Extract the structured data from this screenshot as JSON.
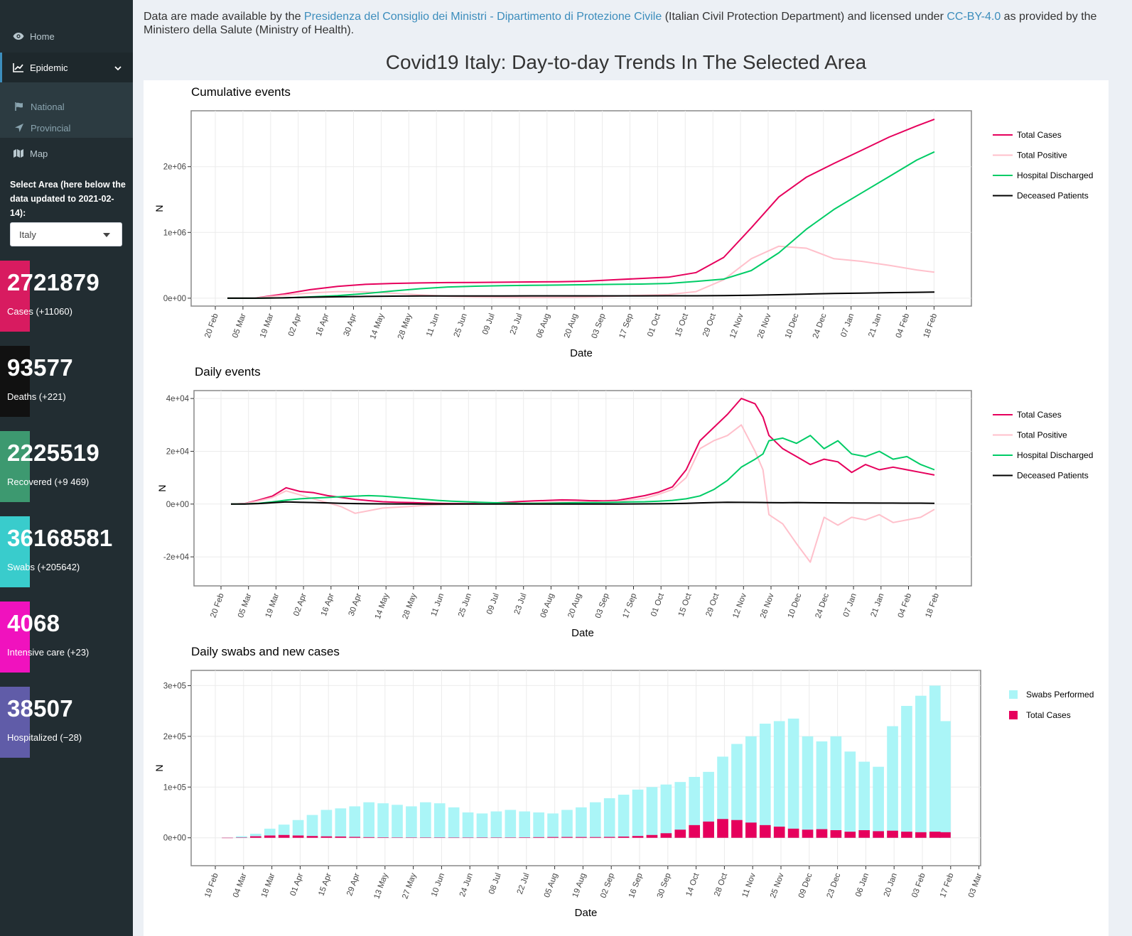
{
  "sidebar": {
    "nav": [
      {
        "label": "Home",
        "icon": "eye-icon"
      },
      {
        "label": "Epidemic",
        "icon": "line-chart-icon"
      },
      {
        "label": "National",
        "icon": "flag-icon"
      },
      {
        "label": "Provincial",
        "icon": "location-arrow-icon"
      },
      {
        "label": "Map",
        "icon": "map-icon"
      }
    ],
    "select_label": "Select Area (here below the data updated to 2021-02-14):",
    "select_value": "Italy",
    "value_boxes": [
      {
        "value": "2721879",
        "label": "Cases (+11060)",
        "color": "#d81b60"
      },
      {
        "value": "93577",
        "label": "Deaths (+221)",
        "color": "#111111"
      },
      {
        "value": "2225519",
        "label": "Recovered (+9 469)",
        "color": "#3d9970"
      },
      {
        "value": "36168581",
        "label": "Swabs (+205642)",
        "color": "#39cccc"
      },
      {
        "value": "4068",
        "label": "Intensive care (+23)",
        "color": "#f012be"
      },
      {
        "value": "38507",
        "label": "Hospitalized (−28)",
        "color": "#605ca8"
      }
    ]
  },
  "header": {
    "t1": "Data are made available by the ",
    "link1": "Presidenza del Consiglio dei Ministri - Dipartimento di Protezione Civile",
    "t2": " (Italian Civil Protection Department) and licensed under ",
    "link2": "CC-BY-4.0",
    "t3": " as provided by the Ministero della Salute (Ministry of Health)."
  },
  "page_title": "Covid19 Italy: Day-to-day Trends In The Selected Area",
  "colors": {
    "total_cases": "#e6005c",
    "total_positive": "#ffc0cb",
    "discharged": "#00cc66",
    "deceased": "#000000",
    "swabs": "#aaf5f7"
  },
  "chart_data": [
    {
      "type": "line",
      "title": "Cumulative events",
      "xlabel": "Date",
      "ylabel": "N",
      "x_ticks": [
        "20 Feb",
        "05 Mar",
        "19 Mar",
        "02 Apr",
        "16 Apr",
        "30 Apr",
        "14 May",
        "28 May",
        "11 Jun",
        "25 Jun",
        "09 Jul",
        "23 Jul",
        "06 Aug",
        "20 Aug",
        "03 Sep",
        "17 Sep",
        "01 Oct",
        "15 Oct",
        "29 Oct",
        "12 Nov",
        "26 Nov",
        "10 Dec",
        "24 Dec",
        "07 Jan",
        "21 Jan",
        "04 Feb",
        "18 Feb"
      ],
      "y_ticks": [
        "0e+00",
        "1e+06",
        "2e+06"
      ],
      "ylim": [
        -120000,
        2850000
      ],
      "legend": "right",
      "x": [
        0,
        14,
        28,
        42,
        56,
        70,
        84,
        98,
        112,
        126,
        140,
        154,
        168,
        182,
        196,
        210,
        224,
        238,
        252,
        266,
        280,
        294,
        308,
        322,
        336,
        350,
        359
      ],
      "series": [
        {
          "name": "Total Cases",
          "color": "#e6005c",
          "values": [
            0,
            2000,
            60000,
            130000,
            180000,
            210000,
            225000,
            232000,
            237000,
            240000,
            243000,
            247000,
            250000,
            258000,
            280000,
            300000,
            320000,
            390000,
            620000,
            1070000,
            1540000,
            1840000,
            2050000,
            2250000,
            2450000,
            2620000,
            2721879
          ]
        },
        {
          "name": "Total Positive",
          "color": "#ffc0cb",
          "values": [
            0,
            1500,
            45000,
            80000,
            100000,
            95000,
            75000,
            50000,
            30000,
            20000,
            15000,
            13000,
            13000,
            17000,
            30000,
            45000,
            55000,
            100000,
            280000,
            600000,
            790000,
            760000,
            600000,
            560000,
            500000,
            430000,
            395000
          ]
        },
        {
          "name": "Hospital Discharged",
          "color": "#00cc66",
          "values": [
            0,
            400,
            4000,
            20000,
            40000,
            70000,
            110000,
            145000,
            170000,
            182000,
            190000,
            195000,
            200000,
            205000,
            210000,
            215000,
            225000,
            255000,
            290000,
            420000,
            690000,
            1050000,
            1350000,
            1600000,
            1850000,
            2100000,
            2225519
          ]
        },
        {
          "name": "Deceased Patients",
          "color": "#000000",
          "values": [
            0,
            100,
            5000,
            15000,
            22000,
            27000,
            31000,
            33000,
            34000,
            34500,
            34900,
            35100,
            35200,
            35400,
            35600,
            36000,
            36500,
            37000,
            38500,
            44000,
            53000,
            63000,
            72000,
            78000,
            84000,
            90000,
            93577
          ]
        }
      ]
    },
    {
      "type": "line",
      "title": "Daily events",
      "xlabel": "Date",
      "ylabel": "N",
      "x_ticks": [
        "20 Feb",
        "05 Mar",
        "19 Mar",
        "02 Apr",
        "16 Apr",
        "30 Apr",
        "14 May",
        "28 May",
        "11 Jun",
        "25 Jun",
        "09 Jul",
        "23 Jul",
        "06 Aug",
        "20 Aug",
        "03 Sep",
        "17 Sep",
        "01 Oct",
        "15 Oct",
        "29 Oct",
        "12 Nov",
        "26 Nov",
        "10 Dec",
        "24 Dec",
        "07 Jan",
        "21 Jan",
        "04 Feb",
        "18 Feb"
      ],
      "y_ticks": [
        "-2e+04",
        "0e+00",
        "2e+04",
        "4e+04"
      ],
      "ylim": [
        -31000,
        43000
      ],
      "legend": "right",
      "x": [
        0,
        7,
        14,
        21,
        28,
        35,
        42,
        49,
        56,
        63,
        70,
        77,
        84,
        91,
        98,
        105,
        112,
        119,
        126,
        133,
        140,
        147,
        154,
        161,
        168,
        175,
        182,
        189,
        196,
        203,
        210,
        217,
        224,
        231,
        238,
        245,
        252,
        259,
        266,
        270,
        273,
        280,
        287,
        294,
        301,
        308,
        315,
        322,
        329,
        336,
        343,
        350,
        357
      ],
      "series": [
        {
          "name": "Total Cases",
          "color": "#e6005c",
          "values": [
            0,
            200,
            1500,
            3000,
            6200,
            4800,
            4300,
            3200,
            2500,
            1800,
            1300,
            900,
            700,
            600,
            400,
            300,
            200,
            200,
            250,
            400,
            700,
            1000,
            1200,
            1400,
            1600,
            1500,
            1300,
            1200,
            1400,
            2300,
            3200,
            4500,
            6500,
            13000,
            24000,
            29000,
            34000,
            40000,
            38000,
            33000,
            26000,
            21000,
            18000,
            15000,
            17000,
            16000,
            12000,
            15000,
            13000,
            14000,
            13000,
            12000,
            11000
          ]
        },
        {
          "name": "Total Positive",
          "color": "#ffc0cb",
          "values": [
            0,
            150,
            1200,
            2500,
            5000,
            3500,
            2000,
            500,
            -1000,
            -3500,
            -2500,
            -1500,
            -1200,
            -900,
            -500,
            -300,
            -100,
            0,
            100,
            200,
            250,
            300,
            400,
            600,
            900,
            800,
            700,
            800,
            1000,
            1600,
            2200,
            3700,
            5500,
            10000,
            21000,
            24000,
            26000,
            30000,
            20000,
            13000,
            -4000,
            -7500,
            -15000,
            -22000,
            -5000,
            -8000,
            -5000,
            -6000,
            -4000,
            -7000,
            -6000,
            -5000,
            -2000
          ]
        },
        {
          "name": "Hospital Discharged",
          "color": "#00cc66",
          "values": [
            0,
            50,
            300,
            800,
            1500,
            2000,
            2300,
            2500,
            2800,
            3000,
            3200,
            3000,
            2600,
            2200,
            1800,
            1400,
            1100,
            900,
            700,
            500,
            400,
            300,
            300,
            350,
            450,
            500,
            550,
            600,
            700,
            800,
            900,
            1100,
            1400,
            2000,
            3100,
            5500,
            9000,
            14000,
            17000,
            19000,
            24000,
            25000,
            23000,
            26000,
            21000,
            24000,
            19000,
            18000,
            20000,
            17000,
            18000,
            15000,
            13000
          ]
        },
        {
          "name": "Deceased Patients",
          "color": "#000000",
          "values": [
            0,
            10,
            200,
            500,
            800,
            700,
            600,
            450,
            300,
            200,
            120,
            80,
            60,
            40,
            20,
            15,
            10,
            10,
            10,
            10,
            10,
            10,
            10,
            10,
            12,
            15,
            20,
            25,
            35,
            55,
            80,
            120,
            200,
            280,
            450,
            600,
            700,
            650,
            620,
            600,
            550,
            500,
            600,
            500,
            480,
            460,
            430,
            420,
            380,
            370,
            360,
            350,
            300
          ]
        }
      ]
    },
    {
      "type": "bar",
      "title": "Daily swabs and new cases",
      "xlabel": "Date",
      "ylabel": "N",
      "x_ticks": [
        "19 Feb",
        "04 Mar",
        "18 Mar",
        "01 Apr",
        "15 Apr",
        "29 Apr",
        "13 May",
        "27 May",
        "10 Jun",
        "24 Jun",
        "08 Jul",
        "22 Jul",
        "05 Aug",
        "19 Aug",
        "02 Sep",
        "16 Sep",
        "30 Sep",
        "14 Oct",
        "28 Oct",
        "11 Nov",
        "25 Nov",
        "09 Dec",
        "23 Dec",
        "06 Jan",
        "20 Jan",
        "03 Feb",
        "17 Feb",
        "03 Mar"
      ],
      "y_ticks": [
        "0e+00",
        "1e+05",
        "2e+05",
        "3e+05"
      ],
      "ylim": [
        -55000,
        330000
      ],
      "legend": "right",
      "x": [
        5,
        12,
        19,
        26,
        33,
        40,
        47,
        54,
        61,
        68,
        75,
        82,
        89,
        96,
        103,
        110,
        117,
        124,
        131,
        138,
        145,
        152,
        159,
        166,
        173,
        180,
        187,
        194,
        201,
        208,
        215,
        222,
        229,
        236,
        243,
        250,
        257,
        264,
        271,
        278,
        285,
        292,
        299,
        306,
        313,
        320,
        327,
        334,
        341,
        348,
        355,
        360
      ],
      "series": [
        {
          "name": "Swabs Performed",
          "color": "#aaf5f7",
          "values": [
            500,
            3000,
            8000,
            18000,
            26000,
            35000,
            45000,
            55000,
            58000,
            62000,
            70000,
            68000,
            65000,
            62000,
            70000,
            68000,
            60000,
            50000,
            48000,
            52000,
            55000,
            52000,
            50000,
            48000,
            55000,
            60000,
            70000,
            78000,
            85000,
            95000,
            100000,
            105000,
            110000,
            120000,
            130000,
            160000,
            185000,
            200000,
            225000,
            230000,
            235000,
            200000,
            190000,
            200000,
            170000,
            150000,
            140000,
            220000,
            260000,
            280000,
            300000,
            230000
          ]
        },
        {
          "name": "Total Cases",
          "color": "#e6005c",
          "values": [
            50,
            300,
            3000,
            4500,
            5500,
            4500,
            3500,
            2800,
            2500,
            1800,
            1200,
            900,
            700,
            600,
            400,
            300,
            250,
            250,
            300,
            400,
            600,
            900,
            1200,
            1500,
            1600,
            1500,
            1400,
            1700,
            2400,
            3500,
            5500,
            9000,
            16000,
            25000,
            32000,
            37000,
            35000,
            30000,
            25000,
            22000,
            18000,
            16000,
            17000,
            15000,
            12000,
            15000,
            13000,
            14000,
            12000,
            11000,
            12000,
            11000
          ]
        }
      ]
    }
  ]
}
